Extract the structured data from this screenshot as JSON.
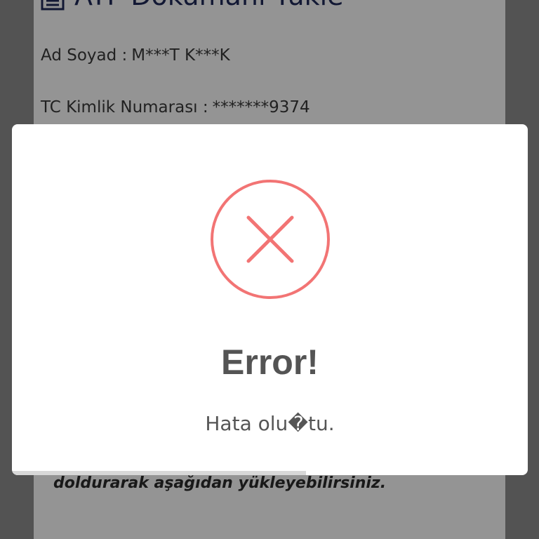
{
  "background": {
    "title": "ATF Dokümanı Yükle",
    "fields": [
      {
        "label": "Ad Soyad :",
        "value": "M***T K***K"
      },
      {
        "label": "TC Kimlik Numarası :",
        "value": "*******9374"
      }
    ],
    "instruction_text": "doldurarak aşağıdan yükleyebilirsiniz."
  },
  "modal": {
    "icon": "error-x-circle-icon",
    "title": "Error!",
    "message": "Hata olu�tu.",
    "timer_progress": 0.57
  },
  "colors": {
    "error_red": "#f27474",
    "title_text": "#545454",
    "navy": "#1f2a5a"
  }
}
